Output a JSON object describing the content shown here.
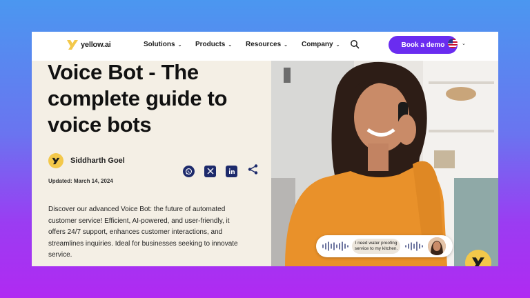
{
  "brand": {
    "name": "yellow.ai"
  },
  "nav": {
    "items": [
      {
        "label": "Solutions"
      },
      {
        "label": "Products"
      },
      {
        "label": "Resources"
      },
      {
        "label": "Company"
      }
    ],
    "cta_label": "Book a demo",
    "language_icon": "us-flag-icon"
  },
  "article": {
    "title": "Voice Bot - The complete guide to voice bots",
    "author": "Siddharth Goel",
    "updated": "Updated: March 14, 2024",
    "description": "Discover our advanced Voice Bot: the future of automated customer service! Efficient, AI-powered, and user-friendly, it offers 24/7 support, enhances customer interactions, and streamlines inquiries. Ideal for businesses seeking to innovate service.",
    "share_icons": [
      "whatsapp-icon",
      "x-icon",
      "linkedin-icon",
      "share-icon"
    ]
  },
  "hero": {
    "voice_message": "I need water proofing service to my kitchen."
  },
  "colors": {
    "accent": "#6a2cf0",
    "brand_yellow": "#f3c84a",
    "share_icon_bg": "#1d2a6b",
    "page_bg": "#f4efe5"
  }
}
